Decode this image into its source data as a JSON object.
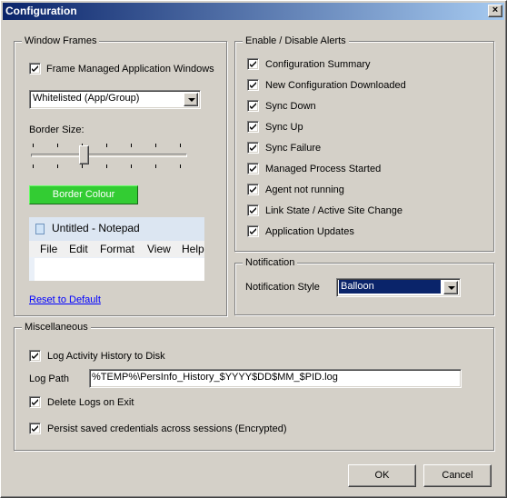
{
  "window": {
    "title": "Configuration",
    "close_glyph": "×"
  },
  "window_frames": {
    "title": "Window Frames",
    "frame_managed_label": "Frame Managed Application Windows",
    "frame_managed_checked": true,
    "mode_value": "Whitelisted (App/Group)",
    "border_size_label": "Border Size:",
    "border_size_level": 0.33,
    "border_colour_label": "Border Colour",
    "border_colour": "#33cc33",
    "preview": {
      "title": "Untitled - Notepad",
      "menu": [
        "File",
        "Edit",
        "Format",
        "View",
        "Help"
      ]
    },
    "reset_label": "Reset to Default"
  },
  "alerts": {
    "title": "Enable / Disable Alerts",
    "items": [
      {
        "label": "Configuration Summary",
        "checked": true
      },
      {
        "label": "New Configuration Downloaded",
        "checked": true
      },
      {
        "label": "Sync Down",
        "checked": true
      },
      {
        "label": "Sync Up",
        "checked": true
      },
      {
        "label": "Sync Failure",
        "checked": true
      },
      {
        "label": "Managed Process Started",
        "checked": true
      },
      {
        "label": "Agent not running",
        "checked": true
      },
      {
        "label": "Link State / Active Site Change",
        "checked": true
      },
      {
        "label": "Application Updates",
        "checked": true
      }
    ]
  },
  "notification": {
    "title": "Notification",
    "style_label": "Notification Style",
    "style_value": "Balloon"
  },
  "misc": {
    "title": "Miscellaneous",
    "log_history_label": "Log Activity History to Disk",
    "log_history_checked": true,
    "log_path_label": "Log Path",
    "log_path_value": "%TEMP%\\PersInfo_History_$YYYY$DD$MM_$PID.log",
    "delete_logs_label": "Delete Logs on Exit",
    "delete_logs_checked": true,
    "persist_label": "Persist saved credentials across sessions (Encrypted)",
    "persist_checked": true
  },
  "buttons": {
    "ok": "OK",
    "cancel": "Cancel"
  },
  "colors": {
    "titlebar_start": "#0a246a",
    "selection": "#0a246a",
    "face": "#d4d0c8"
  }
}
